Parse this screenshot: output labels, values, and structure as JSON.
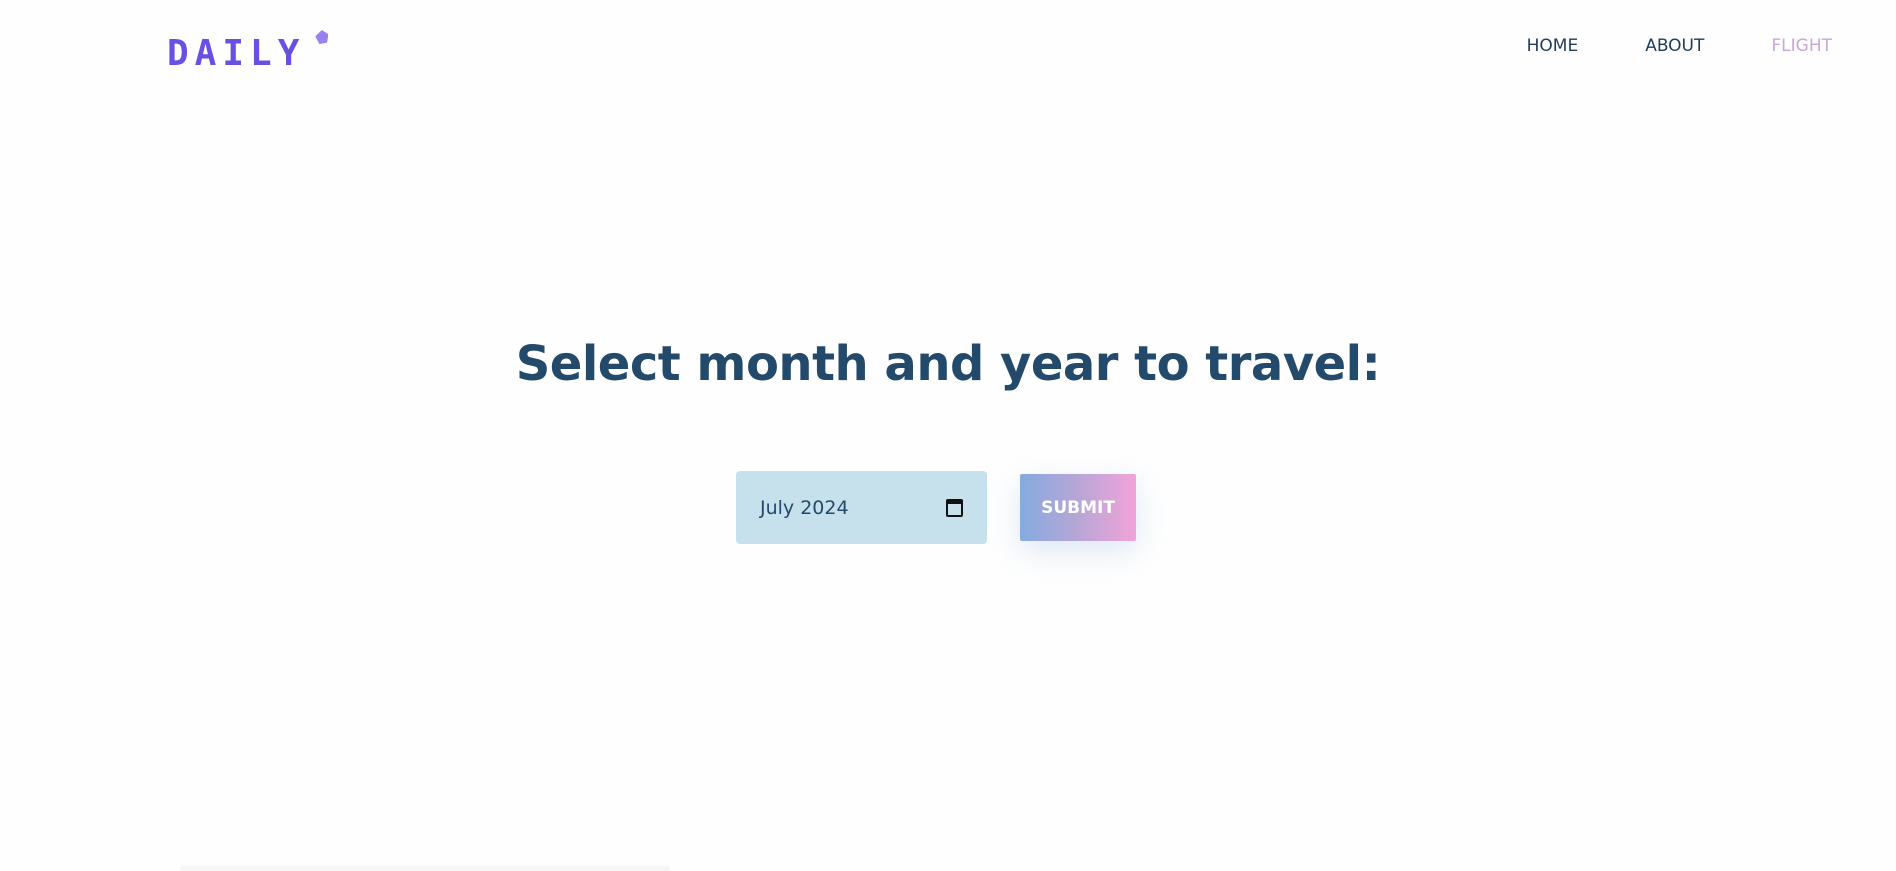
{
  "brand": {
    "logo_text": "DAILY"
  },
  "nav": {
    "items": [
      "HOME",
      "ABOUT",
      "FLIGHT"
    ],
    "active": "FLIGHT"
  },
  "main": {
    "title": "Select month and year to travel:",
    "month_input": {
      "value": "July 2024"
    },
    "submit_label": "SUBMIT"
  },
  "colors": {
    "brand": "#6a4fe4",
    "nav_text": "#1f3c5a",
    "nav_active": "#c9a6dc",
    "title": "#234a6a",
    "input_bg": "#c6e1ec",
    "submit_gradient_start": "#84aadf",
    "submit_gradient_end": "#f2a3d8"
  }
}
